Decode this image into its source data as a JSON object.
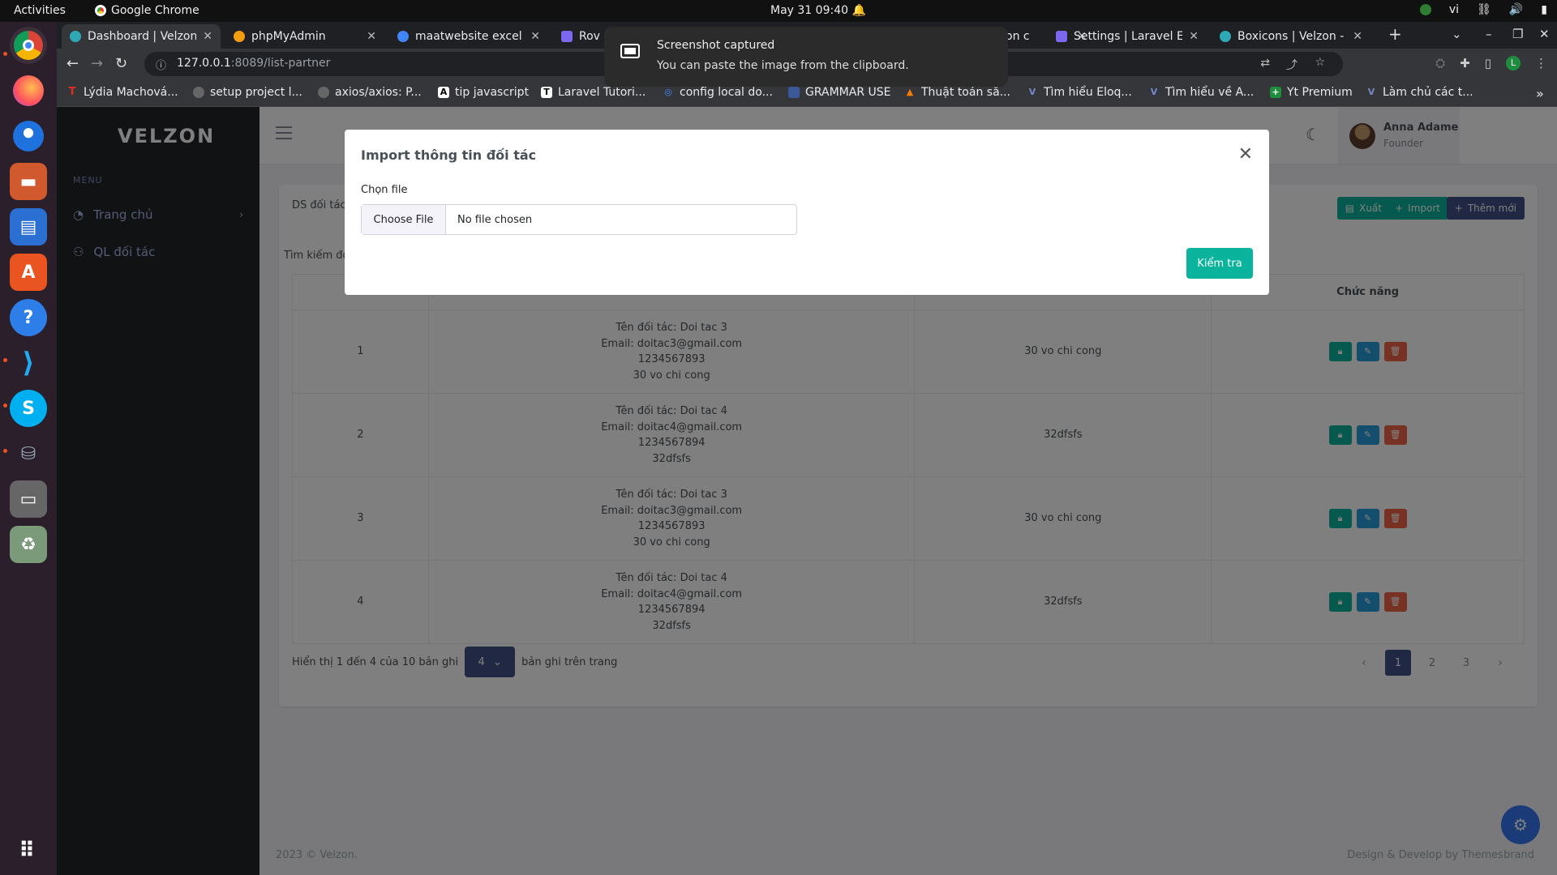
{
  "topbar": {
    "activities": "Activities",
    "app_name": "Google Chrome",
    "clock": "May 31  09:40",
    "lang": "vi"
  },
  "notification": {
    "title": "Screenshot captured",
    "body": "You can paste the image from the clipboard."
  },
  "tabs": [
    {
      "title": "Dashboard | Velzon",
      "color": "#2ea8b5"
    },
    {
      "title": "phpMyAdmin",
      "color": "#f39c12"
    },
    {
      "title": "maatwebsite excel v",
      "color": "#4285f4"
    },
    {
      "title": "Rov",
      "color": "#7b68ee"
    },
    {
      "title": "on c",
      "color": "#7b68ee"
    },
    {
      "title": "Settings | Laravel Ex",
      "color": "#7b68ee"
    },
    {
      "title": "Boxicons | Velzon - A",
      "color": "#2ea8b5"
    }
  ],
  "address": {
    "host": "127.0.0.1",
    "path": ":8089/list-partner"
  },
  "bookmarks": [
    {
      "label": "Lýdia Machová...",
      "icon": "T",
      "color": "#e62b1e"
    },
    {
      "label": "setup project l...",
      "icon": "●",
      "color": "#555"
    },
    {
      "label": "axios/axios: P...",
      "icon": "●",
      "color": "#555"
    },
    {
      "label": "tip javascript",
      "icon": "A",
      "color": "#222"
    },
    {
      "label": "Laravel Tutori...",
      "icon": "T",
      "color": "#222"
    },
    {
      "label": "config local do...",
      "icon": "◎",
      "color": "#4285f4"
    },
    {
      "label": "GRAMMAR USE",
      "icon": "▪",
      "color": "#3b5998"
    },
    {
      "label": "Thuật toán sắ...",
      "icon": "▲",
      "color": "#f57c00"
    },
    {
      "label": "Tìm hiểu Eloq...",
      "icon": "V",
      "color": "#5c6bc0"
    },
    {
      "label": "Tìm hiểu về A...",
      "icon": "V",
      "color": "#5c6bc0"
    },
    {
      "label": "Yt Premium",
      "icon": "+",
      "color": "#1e8e3e"
    },
    {
      "label": "Làm chủ các t...",
      "icon": "V",
      "color": "#5c6bc0"
    }
  ],
  "sidebar": {
    "logo": "VELZON",
    "menu_title": "MENU",
    "items": [
      {
        "label": "Trang chủ"
      },
      {
        "label": "QL đối tác"
      }
    ]
  },
  "header": {
    "user_name": "Anna Adame",
    "user_role": "Founder"
  },
  "card": {
    "title": "DS đối tác",
    "export_label": "Xuất",
    "import_label": "Import",
    "add_label": "Thêm mới",
    "search_label": "Tìm kiếm đối",
    "col_actions": "Chức năng"
  },
  "rows": [
    {
      "no": "1",
      "name": "Tên đối tác: Doi tac 3",
      "email": "Email: doitac3@gmail.com",
      "phone": "1234567893",
      "addr": "30 vo chi cong",
      "address": "30 vo chi cong"
    },
    {
      "no": "2",
      "name": "Tên đối tác: Doi tac 4",
      "email": "Email: doitac4@gmail.com",
      "phone": "1234567894",
      "addr": "32dfsfs",
      "address": "32dfsfs"
    },
    {
      "no": "3",
      "name": "Tên đối tác: Doi tac 3",
      "email": "Email: doitac3@gmail.com",
      "phone": "1234567893",
      "addr": "30 vo chi cong",
      "address": "30 vo chi cong"
    },
    {
      "no": "4",
      "name": "Tên đối tác: Doi tac 4",
      "email": "Email: doitac4@gmail.com",
      "phone": "1234567894",
      "addr": "32dfsfs",
      "address": "32dfsfs"
    }
  ],
  "pagination": {
    "info_before": "Hiển thị 1 đến 4 của 10 bản ghi",
    "per_page": "4",
    "info_after": "bản ghi trên trang",
    "pages": [
      "1",
      "2",
      "3"
    ],
    "prev": "‹",
    "next": "›"
  },
  "footer": {
    "left": "2023 © Velzon.",
    "right": "Design & Develop by Themesbrand"
  },
  "modal": {
    "title": "Import thông tin đối tác",
    "label": "Chọn file",
    "choose": "Choose File",
    "no_file": "No file chosen",
    "submit": "Kiểm tra"
  },
  "colors": {
    "primary": "#405189",
    "success": "#0ab39c",
    "info": "#299cdb",
    "danger": "#f06548"
  }
}
